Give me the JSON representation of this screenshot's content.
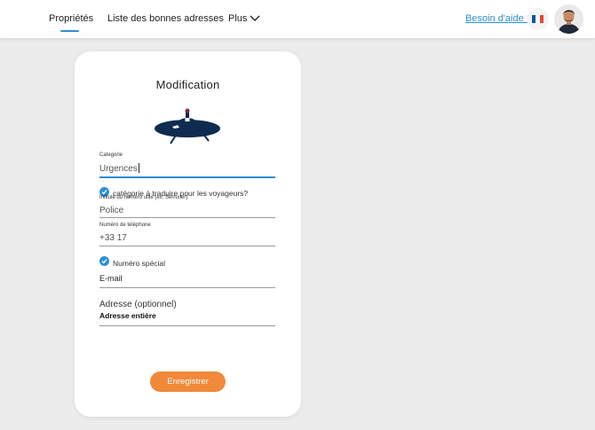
{
  "nav": {
    "items": [
      {
        "label": "Propriétés"
      },
      {
        "label": "Liste des bonnes adresses"
      },
      {
        "label": "Plus"
      }
    ],
    "help_label": "Besoin d'aide ?",
    "flag_colors": [
      "#0055a4",
      "#ffffff",
      "#ef4135"
    ]
  },
  "form": {
    "title": "Modification",
    "category": {
      "label": "Categorie",
      "value": "Urgences"
    },
    "translate_checkbox": {
      "label": "catégorie à traduire pour les voyageurs?",
      "checked": true
    },
    "number_title": {
      "label": "Intitulé du numéro utile (ex: Serrurier)",
      "value": "Police"
    },
    "phone": {
      "label": "Numéro de téléphone",
      "value": "+33 17"
    },
    "special_checkbox": {
      "label": "Numéro spécial",
      "checked": true
    },
    "email": {
      "value": "E-mail"
    },
    "address": {
      "heading": "Adresse (optionnel)",
      "value": "Adresse entière"
    },
    "submit_label": "Enregistrer"
  },
  "colors": {
    "accent": "#2d8fd5",
    "button": "#f0893a",
    "ufo": "#0f2b4f"
  }
}
